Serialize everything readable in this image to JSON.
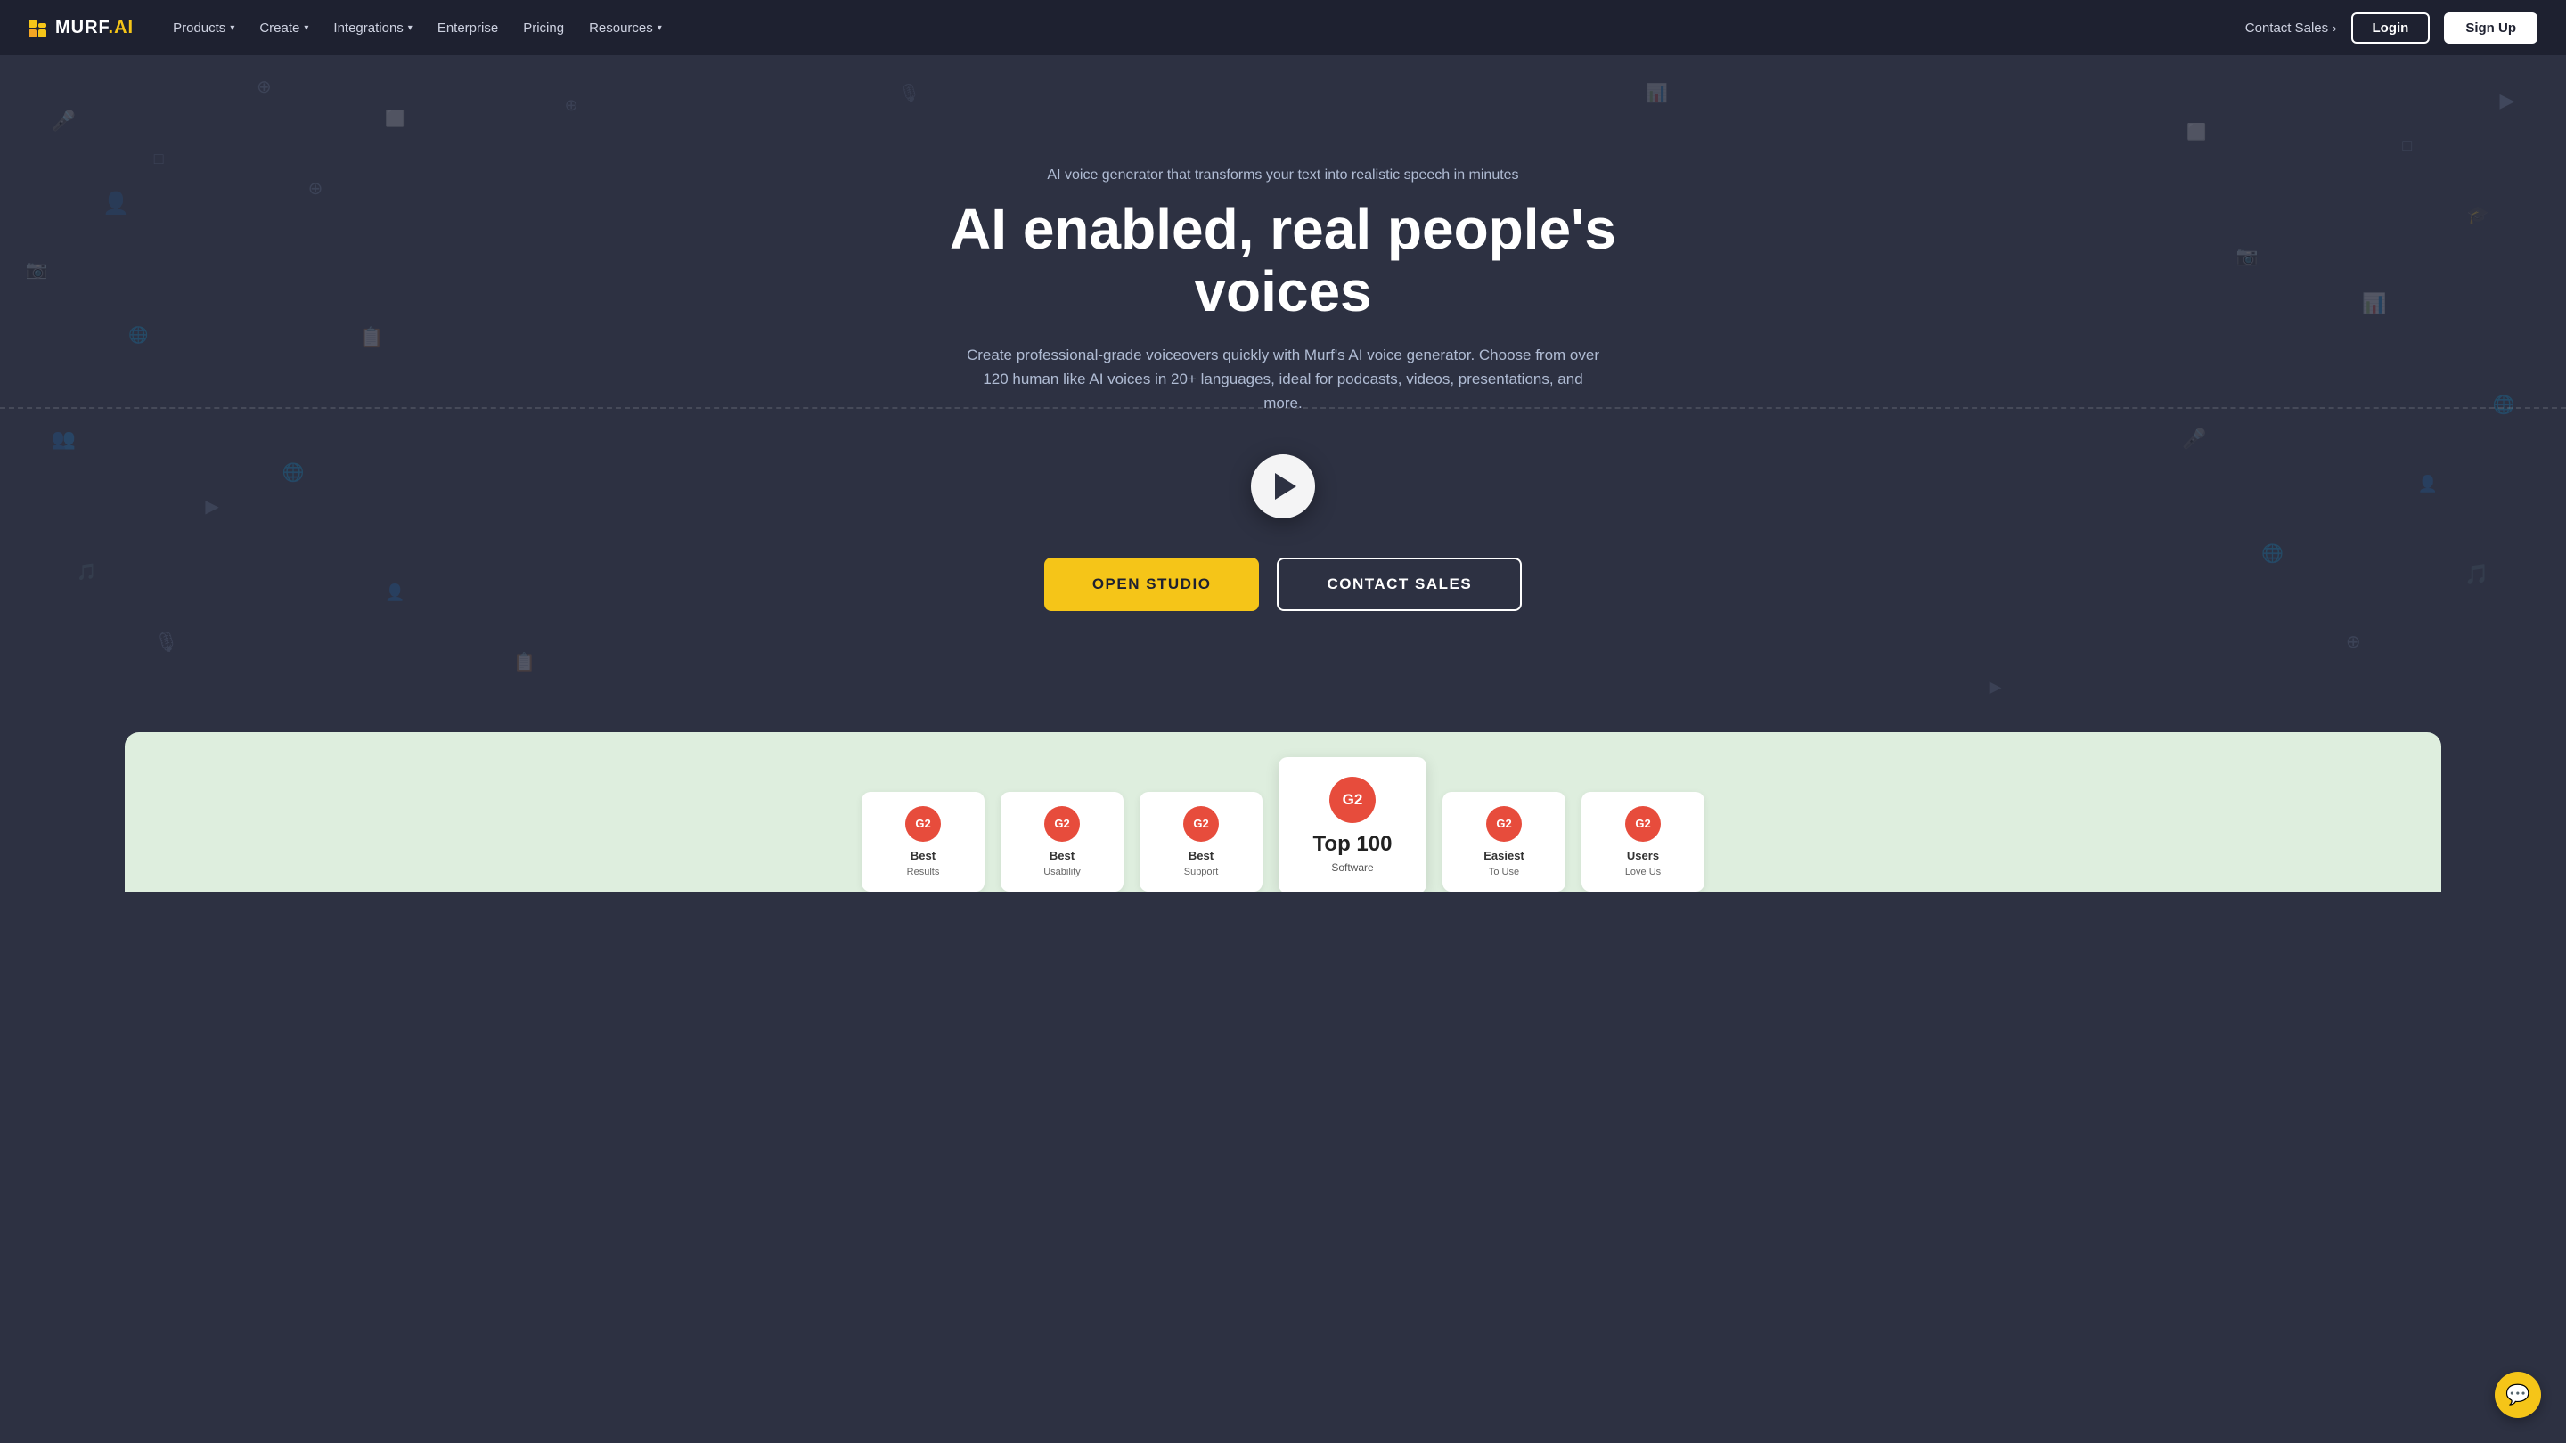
{
  "brand": {
    "name": "MURF.AI",
    "name_styled": "MURF",
    "ai_suffix": ".AI"
  },
  "navbar": {
    "logo_alt": "Murf AI Logo",
    "contact_sales": "Contact Sales",
    "login_label": "Login",
    "signup_label": "Sign Up",
    "nav_items": [
      {
        "label": "Products",
        "has_dropdown": true
      },
      {
        "label": "Create",
        "has_dropdown": true
      },
      {
        "label": "Integrations",
        "has_dropdown": true
      },
      {
        "label": "Enterprise",
        "has_dropdown": false
      },
      {
        "label": "Pricing",
        "has_dropdown": false
      },
      {
        "label": "Resources",
        "has_dropdown": true
      }
    ]
  },
  "hero": {
    "subtitle": "AI voice generator that transforms your text into realistic speech in minutes",
    "title": "AI enabled, real people's voices",
    "description": "Create professional-grade voiceovers quickly with Murf's AI voice generator. Choose from over 120 human like AI voices in 20+ languages, ideal for podcasts, videos, presentations, and more.",
    "open_studio_label": "OPEN STUDIO",
    "contact_sales_label": "CONTACT SALES",
    "play_label": "Play demo"
  },
  "awards": [
    {
      "badge": "G2",
      "label": "Best",
      "sublabel": "Results",
      "featured": false
    },
    {
      "badge": "G2",
      "label": "Best",
      "sublabel": "Usability",
      "featured": false
    },
    {
      "badge": "G2",
      "label": "Best",
      "sublabel": "Support",
      "featured": false
    },
    {
      "badge": "G2",
      "label": "Top 100",
      "sublabel": "Software",
      "featured": true
    },
    {
      "badge": "G2",
      "label": "Easiest",
      "sublabel": "To Use",
      "featured": false
    },
    {
      "badge": "G2",
      "label": "Users",
      "sublabel": "Love Us",
      "featured": false
    }
  ],
  "chat": {
    "label": "Chat support"
  },
  "colors": {
    "brand_yellow": "#f5c518",
    "nav_bg": "#1e2130",
    "hero_bg": "#2d3142",
    "awards_bg": "#e8f5e9"
  }
}
